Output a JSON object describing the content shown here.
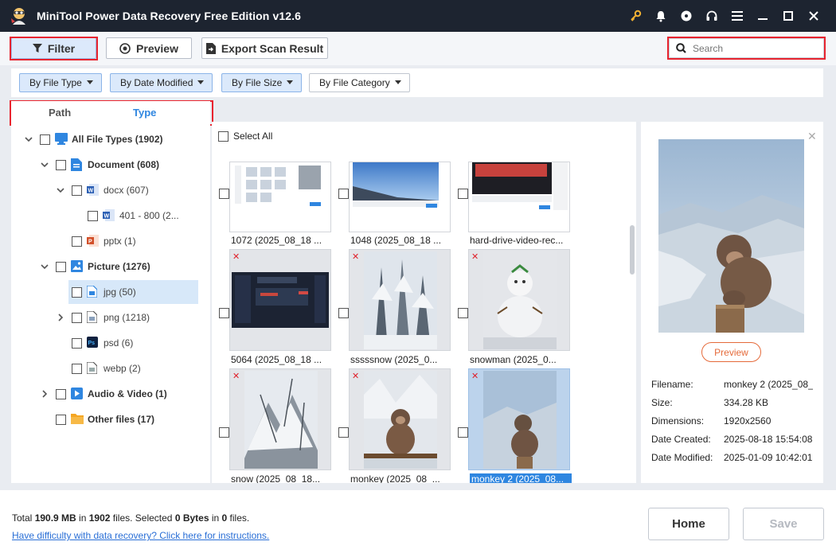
{
  "app": {
    "title": "MiniTool Power Data Recovery Free Edition v12.6",
    "colors": {
      "titlebar": "#1d2430",
      "accent": "#2f86e0",
      "highlight_box": "#e8242f",
      "preview_button": "#e56a3a"
    },
    "window_icons": [
      "key-icon",
      "bell-icon",
      "disc-icon",
      "headphones-icon",
      "menu-icon",
      "minimize-icon",
      "maximize-icon",
      "close-icon"
    ]
  },
  "toolbar": {
    "filter_label": "Filter",
    "preview_label": "Preview",
    "export_label": "Export Scan Result",
    "search_placeholder": "Search"
  },
  "filters": {
    "by_file_type": "By File Type",
    "by_date_modified": "By Date Modified",
    "by_file_size": "By File Size",
    "by_file_category": "By File Category"
  },
  "tabs": {
    "path": "Path",
    "type": "Type",
    "active": "Type"
  },
  "tree": {
    "all": "All File Types (1902)",
    "document": "Document (608)",
    "docx": "docx (607)",
    "range": "401 - 800 (2...",
    "pptx": "pptx (1)",
    "picture": "Picture (1276)",
    "jpg": "jpg (50)",
    "png": "png (1218)",
    "psd": "psd (6)",
    "webp": "webp (2)",
    "audio_video": "Audio & Video (1)",
    "other": "Other files (17)"
  },
  "grid": {
    "select_all": "Select All",
    "items": [
      {
        "name": "1072 (2025_08_18 ...",
        "deleted": false
      },
      {
        "name": "1048 (2025_08_18 ...",
        "deleted": false
      },
      {
        "name": "hard-drive-video-rec...",
        "deleted": false
      },
      {
        "name": "5064 (2025_08_18 ...",
        "deleted": true
      },
      {
        "name": "sssssnow (2025_0...",
        "deleted": true
      },
      {
        "name": "snowman (2025_0...",
        "deleted": true
      },
      {
        "name": "snow (2025_08_18...",
        "deleted": true
      },
      {
        "name": "monkey (2025_08_...",
        "deleted": true
      },
      {
        "name": "monkey 2 (2025_08...",
        "deleted": true,
        "selected": true
      }
    ]
  },
  "preview": {
    "button": "Preview",
    "filename_label": "Filename:",
    "filename": "monkey 2 (2025_08_",
    "size_label": "Size:",
    "size": "334.28 KB",
    "dimensions_label": "Dimensions:",
    "dimensions": "1920x2560",
    "created_label": "Date Created:",
    "created": "2025-08-18 15:54:08",
    "modified_label": "Date Modified:",
    "modified": "2025-01-09 10:42:01"
  },
  "status": {
    "total_prefix": "Total ",
    "total_size": "190.9 MB",
    "in1": " in ",
    "total_files": "1902",
    "files_sel": " files.  Selected ",
    "sel_size": "0 Bytes",
    "in2": " in ",
    "sel_files": "0",
    "files_end": " files.",
    "help": "Have difficulty with data recovery? Click here for instructions."
  },
  "footer": {
    "home": "Home",
    "save": "Save"
  }
}
